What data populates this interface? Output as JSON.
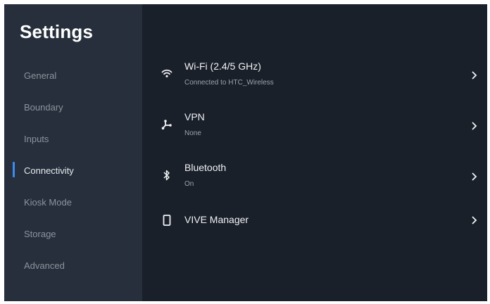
{
  "app": {
    "title": "Settings"
  },
  "sidebar": {
    "items": [
      {
        "label": "General"
      },
      {
        "label": "Boundary"
      },
      {
        "label": "Inputs"
      },
      {
        "label": "Connectivity"
      },
      {
        "label": "Kiosk Mode"
      },
      {
        "label": "Storage"
      },
      {
        "label": "Advanced"
      }
    ],
    "active_item": "Connectivity"
  },
  "main": {
    "rows": [
      {
        "title": "Wi-Fi (2.4/5 GHz)",
        "subtitle": "Connected to HTC_Wireless",
        "icon": "wifi-icon"
      },
      {
        "title": "VPN",
        "subtitle": "None",
        "icon": "vpn-icon"
      },
      {
        "title": "Bluetooth",
        "subtitle": "On",
        "icon": "bluetooth-icon"
      },
      {
        "title": "VIVE Manager",
        "icon": "phone-icon"
      }
    ]
  },
  "colors": {
    "background": "#1a2029",
    "sidebar": "#262f3b",
    "accent": "#3d8cf0",
    "text_primary": "#f0f3f7",
    "text_muted": "#8b939e"
  }
}
